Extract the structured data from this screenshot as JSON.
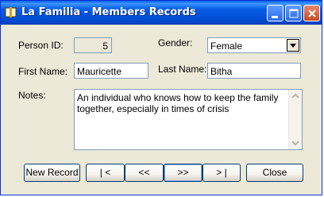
{
  "window": {
    "title": "La Familia - Members Records"
  },
  "form": {
    "person_id_label": "Person ID:",
    "person_id_value": "5",
    "gender_label": "Gender:",
    "gender_value": "Female",
    "first_name_label": "First Name:",
    "first_name_value": "Mauricette",
    "last_name_label": "Last Name:",
    "last_name_value": "Bitha",
    "notes_label": "Notes:",
    "notes_value": "An individual who knows how to keep the family together, especially in times of crisis"
  },
  "buttons": {
    "new_record": "New Record",
    "first": "| <",
    "previous": "<<",
    "next": ">>",
    "last": "> |",
    "close": "Close"
  },
  "icons": {
    "app": "book-icon",
    "minimize": "minimize-icon",
    "maximize": "maximize-icon",
    "close": "close-icon",
    "dropdown": "chevron-down-icon"
  },
  "colors": {
    "titlebar": "#0A5FE6",
    "window_bg": "#ECE9D8",
    "border": "#7F9DB9"
  }
}
